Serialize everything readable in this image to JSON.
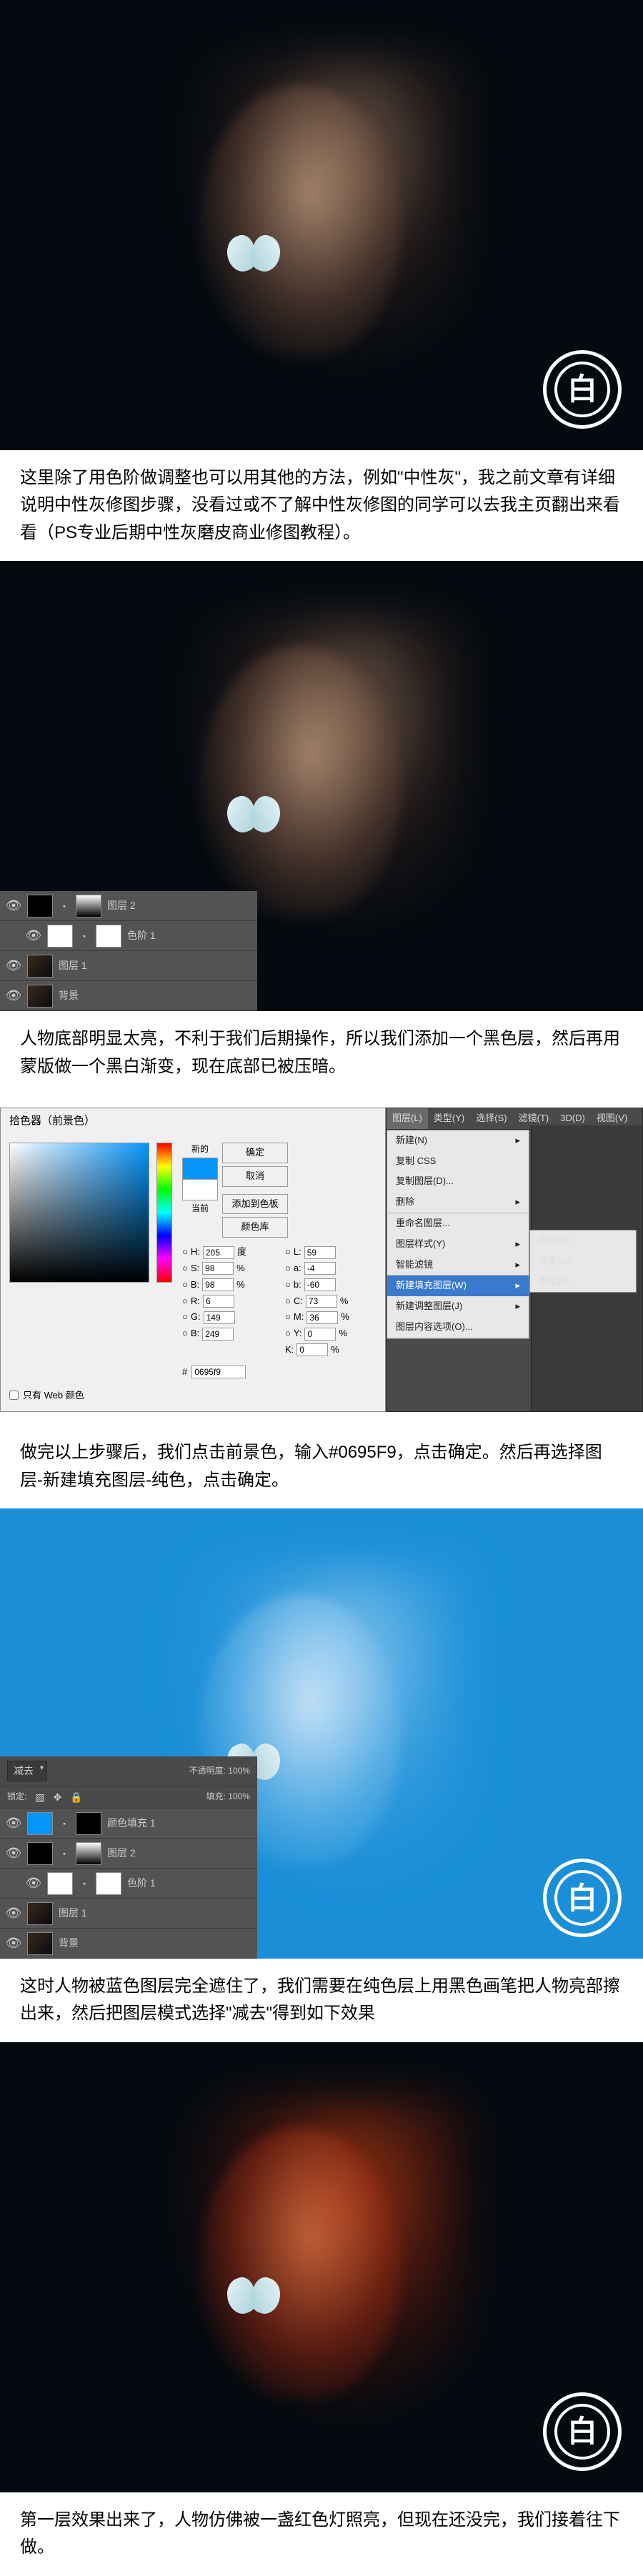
{
  "watermark": {
    "char": "白"
  },
  "paragraphs": {
    "p1": "这里除了用色阶做调整也可以用其他的方法，例如\"中性灰\"，我之前文章有详细说明中性灰修图步骤，没看过或不了解中性灰修图的同学可以去我主页翻出来看看（PS专业后期中性灰磨皮商业修图教程）。",
    "p2": "人物底部明显太亮，不利于我们后期操作，所以我们添加一个黑色层，然后再用蒙版做一个黑白渐变，现在底部已被压暗。",
    "p3": "做完以上步骤后，我们点击前景色，输入#0695F9，点击确定。然后再选择图层-新建填充图层-纯色，点击确定。",
    "p4": "这时人物被蓝色图层完全遮住了，我们需要在纯色层上用黑色画笔把人物亮部擦出来，然后把图层模式选择\"减去\"得到如下效果",
    "p5": "第一层效果出来了，人物仿佛被一盏红色灯照亮，但现在还没完，我们接着往下做。"
  },
  "layers_panel_1": {
    "rows": [
      {
        "name": "图层 2",
        "thumb": "black",
        "mask": "gradient"
      },
      {
        "name": "色阶 1",
        "thumb": "white",
        "mask": "white",
        "sub": true
      },
      {
        "name": "图层 1",
        "thumb": "portrait"
      },
      {
        "name": "背景",
        "thumb": "portrait"
      }
    ]
  },
  "color_picker": {
    "title": "拾色器（前景色）",
    "new_label": "新的",
    "current_label": "当前",
    "ok": "确定",
    "cancel": "取消",
    "add_swatch": "添加到色板",
    "color_lib": "颜色库",
    "fields": {
      "H": "205",
      "H_unit": "度",
      "S": "98",
      "S_unit": "%",
      "B": "98",
      "B_unit": "%",
      "R": "6",
      "G": "149",
      "B2": "249",
      "L": "59",
      "a": "-4",
      "b": "-60",
      "C": "73",
      "C_unit": "%",
      "M": "36",
      "M_unit": "%",
      "Y": "0",
      "Y_unit": "%",
      "K": "0",
      "K_unit": "%"
    },
    "hex_label": "#",
    "hex_value": "0695f9",
    "web_only": "只有 Web 颜色"
  },
  "menu": {
    "bar": [
      "图层(L)",
      "类型(Y)",
      "选择(S)",
      "滤镜(T)",
      "3D(D)",
      "视图(V)"
    ],
    "active_bar": "图层(L)",
    "items": [
      {
        "label": "新建(N)",
        "arrow": true
      },
      {
        "label": "复制 CSS"
      },
      {
        "label": "复制图层(D)..."
      },
      {
        "label": "删除",
        "arrow": true,
        "sep": true
      },
      {
        "label": "重命名图层..."
      },
      {
        "label": "图层样式(Y)",
        "arrow": true
      },
      {
        "label": "智能滤镜",
        "arrow": true,
        "sep": true
      },
      {
        "label": "新建填充图层(W)",
        "arrow": true,
        "highlighted": true
      },
      {
        "label": "新建调整图层(J)",
        "arrow": true
      },
      {
        "label": "图层内容选项(O)...",
        "sep": true
      }
    ],
    "submenu": [
      {
        "label": "纯色(O)..."
      },
      {
        "label": "渐变(G)..."
      },
      {
        "label": "图案(R)..."
      }
    ]
  },
  "layers_panel_2": {
    "blend_mode": "减去",
    "opacity_label": "不透明度:",
    "opacity_value": "100%",
    "lock_label": "锁定:",
    "fill_label": "填充:",
    "fill_value": "100%",
    "rows": [
      {
        "name": "颜色填充 1",
        "thumb": "blue",
        "mask": "black"
      },
      {
        "name": "图层 2",
        "thumb": "black",
        "mask": "gradient"
      },
      {
        "name": "色阶 1",
        "thumb": "white",
        "mask": "white",
        "sub": true
      },
      {
        "name": "图层 1",
        "thumb": "portrait"
      },
      {
        "name": "背景",
        "thumb": "portrait"
      }
    ]
  }
}
